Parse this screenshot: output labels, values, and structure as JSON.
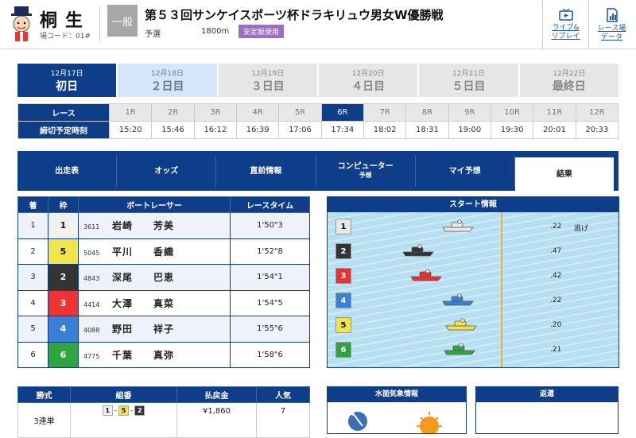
{
  "header": {
    "venue_name": "桐生",
    "venue_code": "場コード：01#",
    "grade": "一般",
    "race_title": "第５３回サンケイスポーツ杯ドラキリュウ男女W優勝戦",
    "race_kind": "予選",
    "distance": "1800m",
    "stabilizer_badge": "安定板使用",
    "buttons": [
      {
        "label_line1": "ライブ&",
        "label_line2": "リプレイ",
        "icon": "tv-icon"
      },
      {
        "label_line1": "レース場",
        "label_line2": "データ",
        "icon": "document-chart-icon"
      }
    ]
  },
  "days": [
    {
      "date": "12月17日",
      "label": "初日",
      "state": "active"
    },
    {
      "date": "12月18日",
      "label": "２日目",
      "state": "next"
    },
    {
      "date": "12月19日",
      "label": "３日目",
      "state": "future"
    },
    {
      "date": "12月20日",
      "label": "４日目",
      "state": "future"
    },
    {
      "date": "12月21日",
      "label": "５日目",
      "state": "future"
    },
    {
      "date": "12月22日",
      "label": "最終日",
      "state": "future"
    }
  ],
  "race_times": {
    "race_label": "レース",
    "deadline_label": "締切予定時刻",
    "races": [
      "1R",
      "2R",
      "3R",
      "4R",
      "5R",
      "6R",
      "7R",
      "8R",
      "9R",
      "10R",
      "11R",
      "12R"
    ],
    "times": [
      "15:20",
      "15:46",
      "16:12",
      "16:39",
      "17:06",
      "17:34",
      "18:02",
      "18:31",
      "19:00",
      "19:30",
      "20:01",
      "20:33"
    ],
    "current_index": 5
  },
  "menu": [
    {
      "label": "出走表",
      "sub": ""
    },
    {
      "label": "オッズ",
      "sub": ""
    },
    {
      "label": "直前情報",
      "sub": ""
    },
    {
      "label": "コンピューター",
      "sub": "予想"
    },
    {
      "label": "マイ予想",
      "sub": ""
    },
    {
      "label": "結果",
      "sub": "",
      "active": true
    }
  ],
  "result": {
    "headers": [
      "着",
      "枠",
      "ボートレーサー",
      "レースタイム"
    ],
    "rows": [
      {
        "place": "1",
        "frame": "1",
        "racer_id": "3611",
        "name": "岩崎　　芳美",
        "time": "1'50\"3"
      },
      {
        "place": "2",
        "frame": "5",
        "racer_id": "5045",
        "name": "平川　　香織",
        "time": "1'52\"8"
      },
      {
        "place": "3",
        "frame": "2",
        "racer_id": "4843",
        "name": "深尾　　巴恵",
        "time": "1'54\"1"
      },
      {
        "place": "4",
        "frame": "3",
        "racer_id": "4414",
        "name": "大澤　　真菜",
        "time": "1'54\"5"
      },
      {
        "place": "5",
        "frame": "4",
        "racer_id": "4088",
        "name": "野田　　祥子",
        "time": "1'55\"6"
      },
      {
        "place": "6",
        "frame": "6",
        "racer_id": "4775",
        "name": "千葉　　真弥",
        "time": "1'58\"6"
      }
    ]
  },
  "start_info": {
    "title": "スタート情報",
    "entries": [
      {
        "lane": "1",
        "st": ".22",
        "tactic": "逃げ",
        "color": "#e8e8e8"
      },
      {
        "lane": "2",
        "st": ".47",
        "tactic": "",
        "color": "#333333"
      },
      {
        "lane": "3",
        "st": ".42",
        "tactic": "",
        "color": "#e33333"
      },
      {
        "lane": "4",
        "st": ".22",
        "tactic": "",
        "color": "#3a7fd6"
      },
      {
        "lane": "5",
        "st": ".20",
        "tactic": "",
        "color": "#f3e34a"
      },
      {
        "lane": "6",
        "st": ".21",
        "tactic": "",
        "color": "#2ea53d"
      }
    ]
  },
  "payout": {
    "headers": [
      "勝式",
      "組番",
      "払戻金",
      "人気"
    ],
    "rows": [
      {
        "type": "3連単",
        "combo": [
          "1",
          "5",
          "2"
        ],
        "amount": "¥1,860",
        "popularity": "7"
      }
    ]
  },
  "weather_title": "水面気象情報",
  "refund_title": "返還"
}
